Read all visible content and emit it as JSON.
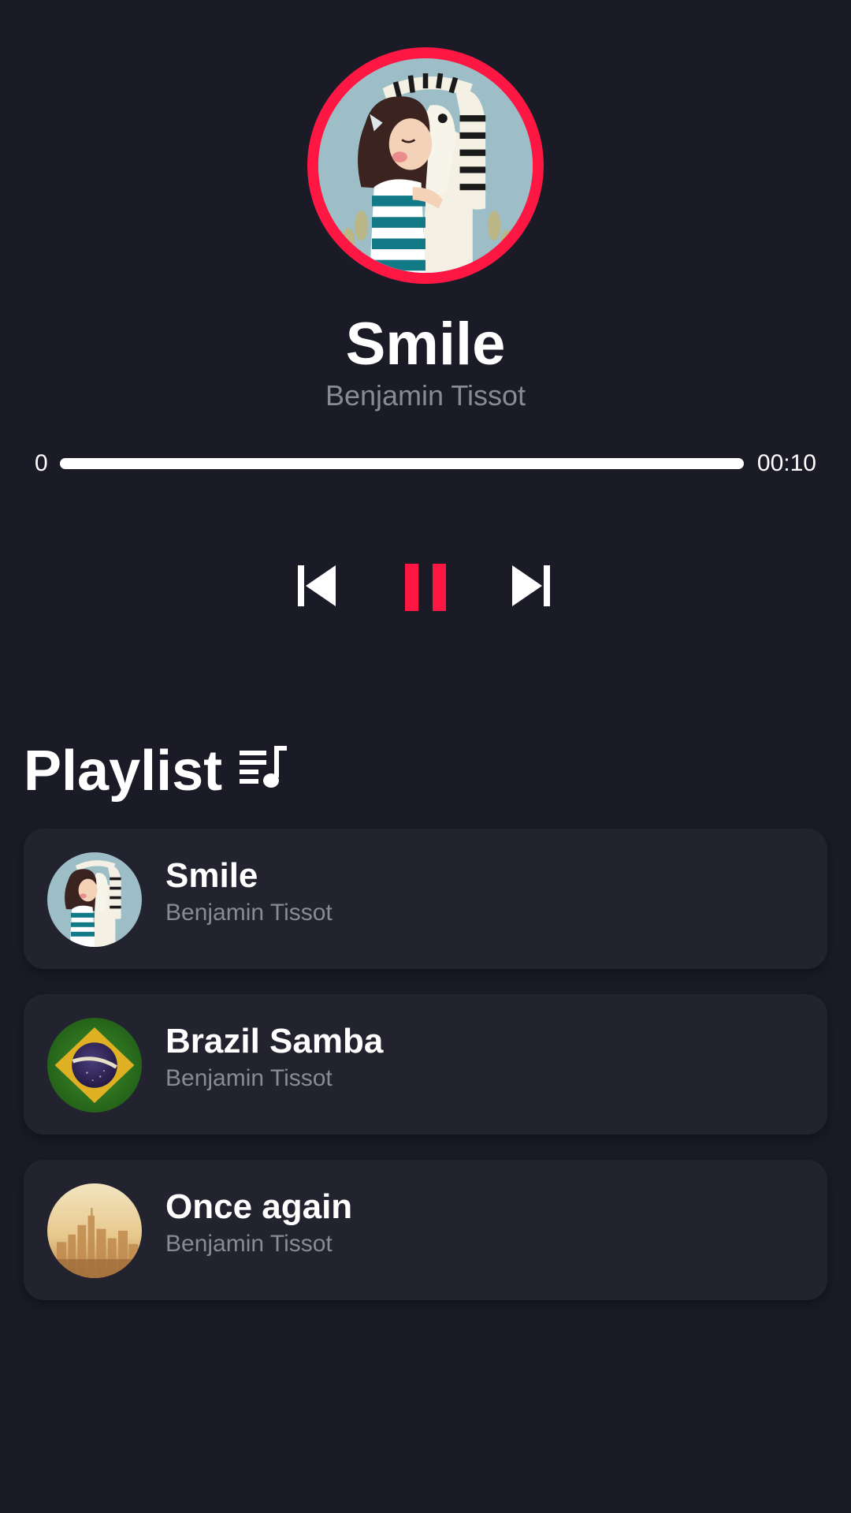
{
  "now_playing": {
    "title": "Smile",
    "artist": "Benjamin Tissot",
    "cover_icon": "girl-hugging-zebra-illustration",
    "progress": {
      "current_label": "0",
      "total_label": "00:10",
      "fraction": 1.0
    }
  },
  "controls": {
    "prev_icon": "skip-previous-icon",
    "pause_icon": "pause-icon",
    "next_icon": "skip-next-icon"
  },
  "playlist": {
    "title": "Playlist",
    "icon": "queue-music-icon",
    "items": [
      {
        "title": "Smile",
        "artist": "Benjamin Tissot",
        "thumb": "girl-zebra-thumbnail"
      },
      {
        "title": "Brazil Samba",
        "artist": "Benjamin Tissot",
        "thumb": "brazil-flag-thumbnail"
      },
      {
        "title": "Once again",
        "artist": "Benjamin Tissot",
        "thumb": "city-skyline-thumbnail"
      }
    ]
  },
  "colors": {
    "background": "#1b1b27",
    "card": "#22232f",
    "accent": "#ff1744",
    "secondary_text": "#8a8a92"
  }
}
